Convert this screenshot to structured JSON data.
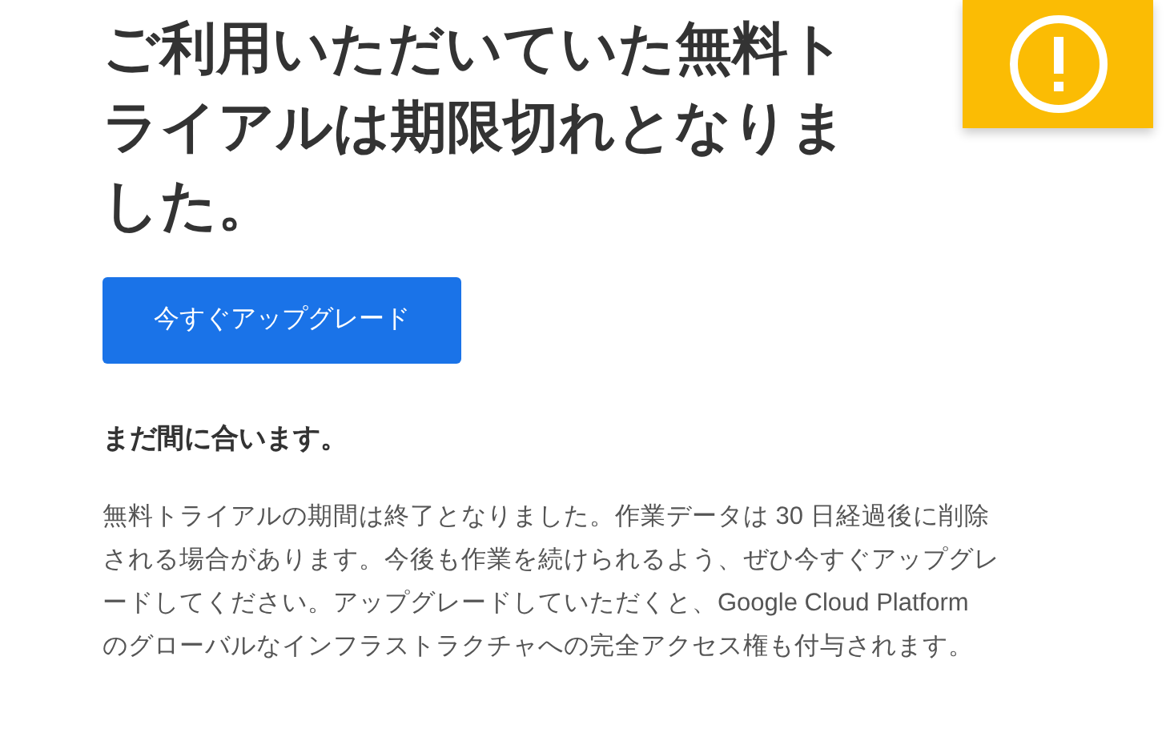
{
  "heading": "ご利用いただいていた無料トライアルは期限切れとなりました。",
  "upgrade_button": "今すぐアップグレード",
  "subheading": "まだ間に合います。",
  "body": "無料トライアルの期間は終了となりました。作業データは 30 日経過後に削除される場合があります。今後も作業を続けられるよう、ぜひ今すぐアップグレードしてください。アップグレードしていただくと、Google Cloud Platform のグローバルなインフラストラクチャへの完全アクセス権も付与されます。"
}
